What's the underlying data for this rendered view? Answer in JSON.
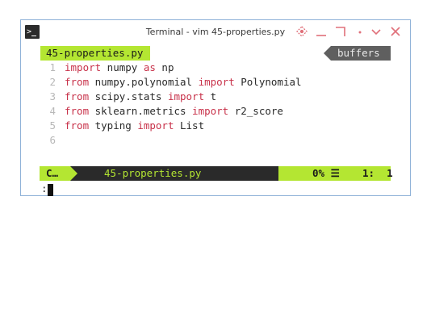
{
  "window": {
    "title": "Terminal - vim 45-properties.py"
  },
  "titlebar_icons": [
    "terminal-app-icon",
    "pin-icon",
    "minimize-icon",
    "maximize-icon",
    "shade-icon",
    "close-icon"
  ],
  "tabline": {
    "active_tab": "45-properties.py",
    "buffers_label": "buffers"
  },
  "code": [
    {
      "num": "1",
      "parts": [
        [
          "kw",
          "import"
        ],
        [
          "txt",
          " numpy "
        ],
        [
          "kw",
          "as"
        ],
        [
          "txt",
          " np"
        ]
      ]
    },
    {
      "num": "2",
      "parts": [
        [
          "kw",
          "from"
        ],
        [
          "txt",
          " numpy.polynomial "
        ],
        [
          "kw",
          "import"
        ],
        [
          "txt",
          " Polynomial"
        ]
      ]
    },
    {
      "num": "3",
      "parts": [
        [
          "kw",
          "from"
        ],
        [
          "txt",
          " scipy.stats "
        ],
        [
          "kw",
          "import"
        ],
        [
          "txt",
          " t"
        ]
      ]
    },
    {
      "num": "4",
      "parts": [
        [
          "kw",
          "from"
        ],
        [
          "txt",
          " sklearn.metrics "
        ],
        [
          "kw",
          "import"
        ],
        [
          "txt",
          " r2_score"
        ]
      ]
    },
    {
      "num": "5",
      "parts": [
        [
          "kw",
          "from"
        ],
        [
          "txt",
          " typing "
        ],
        [
          "kw",
          "import"
        ],
        [
          "txt",
          " List"
        ]
      ]
    },
    {
      "num": "6",
      "parts": []
    }
  ],
  "statusline": {
    "mode": "C…",
    "filename": "45-properties.py",
    "percent": "0% ☰",
    "position": "1:  1"
  },
  "cmdline": {
    "prompt": ":"
  },
  "colors": {
    "accent": "#b4e632",
    "keyword": "#c8324a",
    "statusbar_dark": "#2a2a2a",
    "buffers_bg": "#5f5f5f"
  }
}
